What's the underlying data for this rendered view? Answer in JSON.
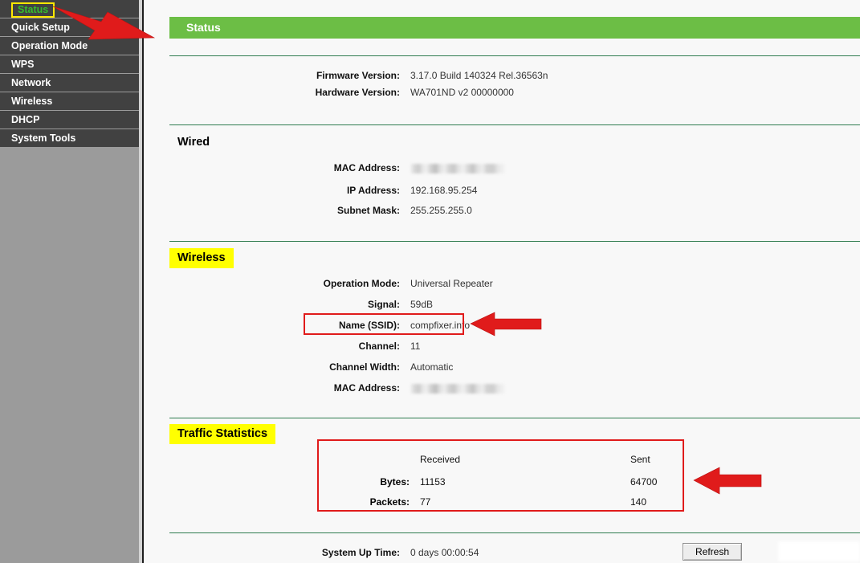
{
  "sidebar": {
    "items": [
      {
        "label": "Status",
        "active": true
      },
      {
        "label": "Quick Setup",
        "active": false
      },
      {
        "label": "Operation Mode",
        "active": false
      },
      {
        "label": "WPS",
        "active": false
      },
      {
        "label": "Network",
        "active": false
      },
      {
        "label": "Wireless",
        "active": false
      },
      {
        "label": "DHCP",
        "active": false
      },
      {
        "label": "System Tools",
        "active": false
      }
    ]
  },
  "page": {
    "banner_title": "Status"
  },
  "device_info": {
    "rows": [
      {
        "label": "Firmware Version:",
        "value": "3.17.0 Build 140324 Rel.36563n"
      },
      {
        "label": "Hardware Version:",
        "value": "WA701ND v2 00000000"
      }
    ]
  },
  "wired": {
    "title": "Wired",
    "rows": [
      {
        "label": "MAC Address:",
        "value": "",
        "redacted": true
      },
      {
        "label": "IP Address:",
        "value": "192.168.95.254",
        "redacted": false
      },
      {
        "label": "Subnet Mask:",
        "value": "255.255.255.0",
        "redacted": false
      }
    ]
  },
  "wireless": {
    "title": "Wireless",
    "rows": [
      {
        "label": "Operation Mode:",
        "value": "Universal Repeater",
        "redacted": false
      },
      {
        "label": "Signal:",
        "value": "59dB",
        "redacted": false
      },
      {
        "label": "Name (SSID):",
        "value": "compfixer.info",
        "redacted": false
      },
      {
        "label": "Channel:",
        "value": "11",
        "redacted": false
      },
      {
        "label": "Channel Width:",
        "value": "Automatic",
        "redacted": false
      },
      {
        "label": "MAC Address:",
        "value": "",
        "redacted": true
      }
    ]
  },
  "traffic": {
    "title": "Traffic Statistics",
    "col_received": "Received",
    "col_sent": "Sent",
    "rows": [
      {
        "label": "Bytes:",
        "received": "11153",
        "sent": "64700"
      },
      {
        "label": "Packets:",
        "received": "77",
        "sent": "140"
      }
    ]
  },
  "footer": {
    "uptime_label": "System Up Time:",
    "uptime_value": "0 days 00:00:54",
    "refresh_label": "Refresh"
  },
  "colors": {
    "banner_green": "#6cbe45",
    "rule_green": "#2f7c4f",
    "highlight_yellow": "#ffff00",
    "annotation_red": "#e01b1b",
    "menu_dark": "#414141",
    "sidebar_gray": "#9b9b9b",
    "active_text_green": "#36bd2d"
  }
}
